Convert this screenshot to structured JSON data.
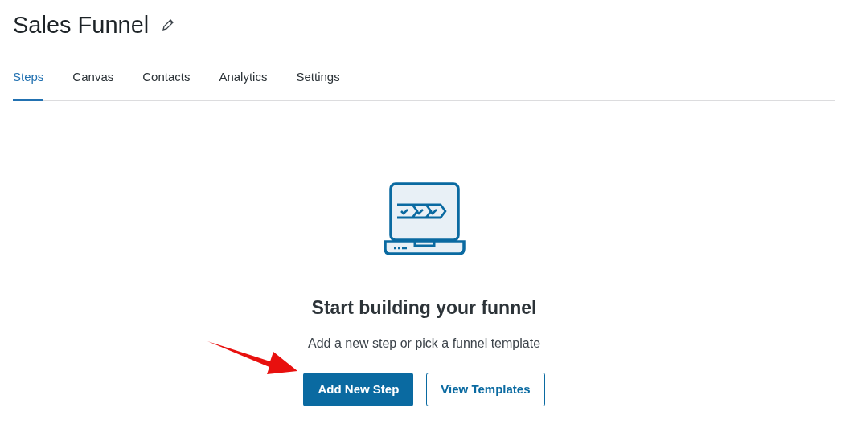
{
  "title": "Sales Funnel",
  "tabs": [
    {
      "label": "Steps",
      "selected": true
    },
    {
      "label": "Canvas",
      "selected": false
    },
    {
      "label": "Contacts",
      "selected": false
    },
    {
      "label": "Analytics",
      "selected": false
    },
    {
      "label": "Settings",
      "selected": false
    }
  ],
  "empty_state": {
    "heading": "Start building your funnel",
    "text": "Add a new step or pick a funnel template",
    "buttons": [
      {
        "label": "Add New Step",
        "kind": "primary"
      },
      {
        "label": "View Templates",
        "kind": "outline"
      }
    ]
  }
}
